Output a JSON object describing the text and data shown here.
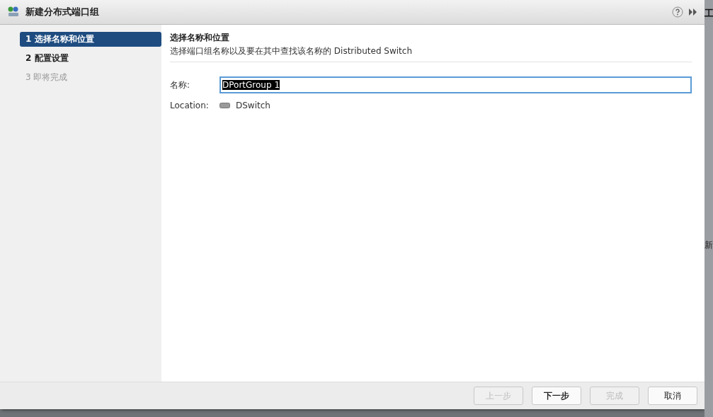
{
  "window": {
    "title": "新建分布式端口组"
  },
  "steps": [
    {
      "number": "1",
      "label": "选择名称和位置",
      "selected": true,
      "disabled": false
    },
    {
      "number": "2",
      "label": "配置设置",
      "selected": false,
      "disabled": false
    },
    {
      "number": "3",
      "label": "即将完成",
      "selected": false,
      "disabled": true
    }
  ],
  "page": {
    "title": "选择名称和位置",
    "subtitle": "选择端口组名称以及要在其中查找该名称的 Distributed Switch"
  },
  "form": {
    "name_label": "名称:",
    "name_value": "DPortGroup 1",
    "location_label": "Location:",
    "location_value": "DSwitch"
  },
  "buttons": [
    {
      "label": "上一步",
      "disabled": true,
      "primary": false
    },
    {
      "label": "下一步",
      "disabled": false,
      "primary": true
    },
    {
      "label": "完成",
      "disabled": true,
      "primary": false
    },
    {
      "label": "取消",
      "disabled": false,
      "primary": false
    }
  ],
  "background": {
    "text_1": "工",
    "text_2": "新"
  }
}
